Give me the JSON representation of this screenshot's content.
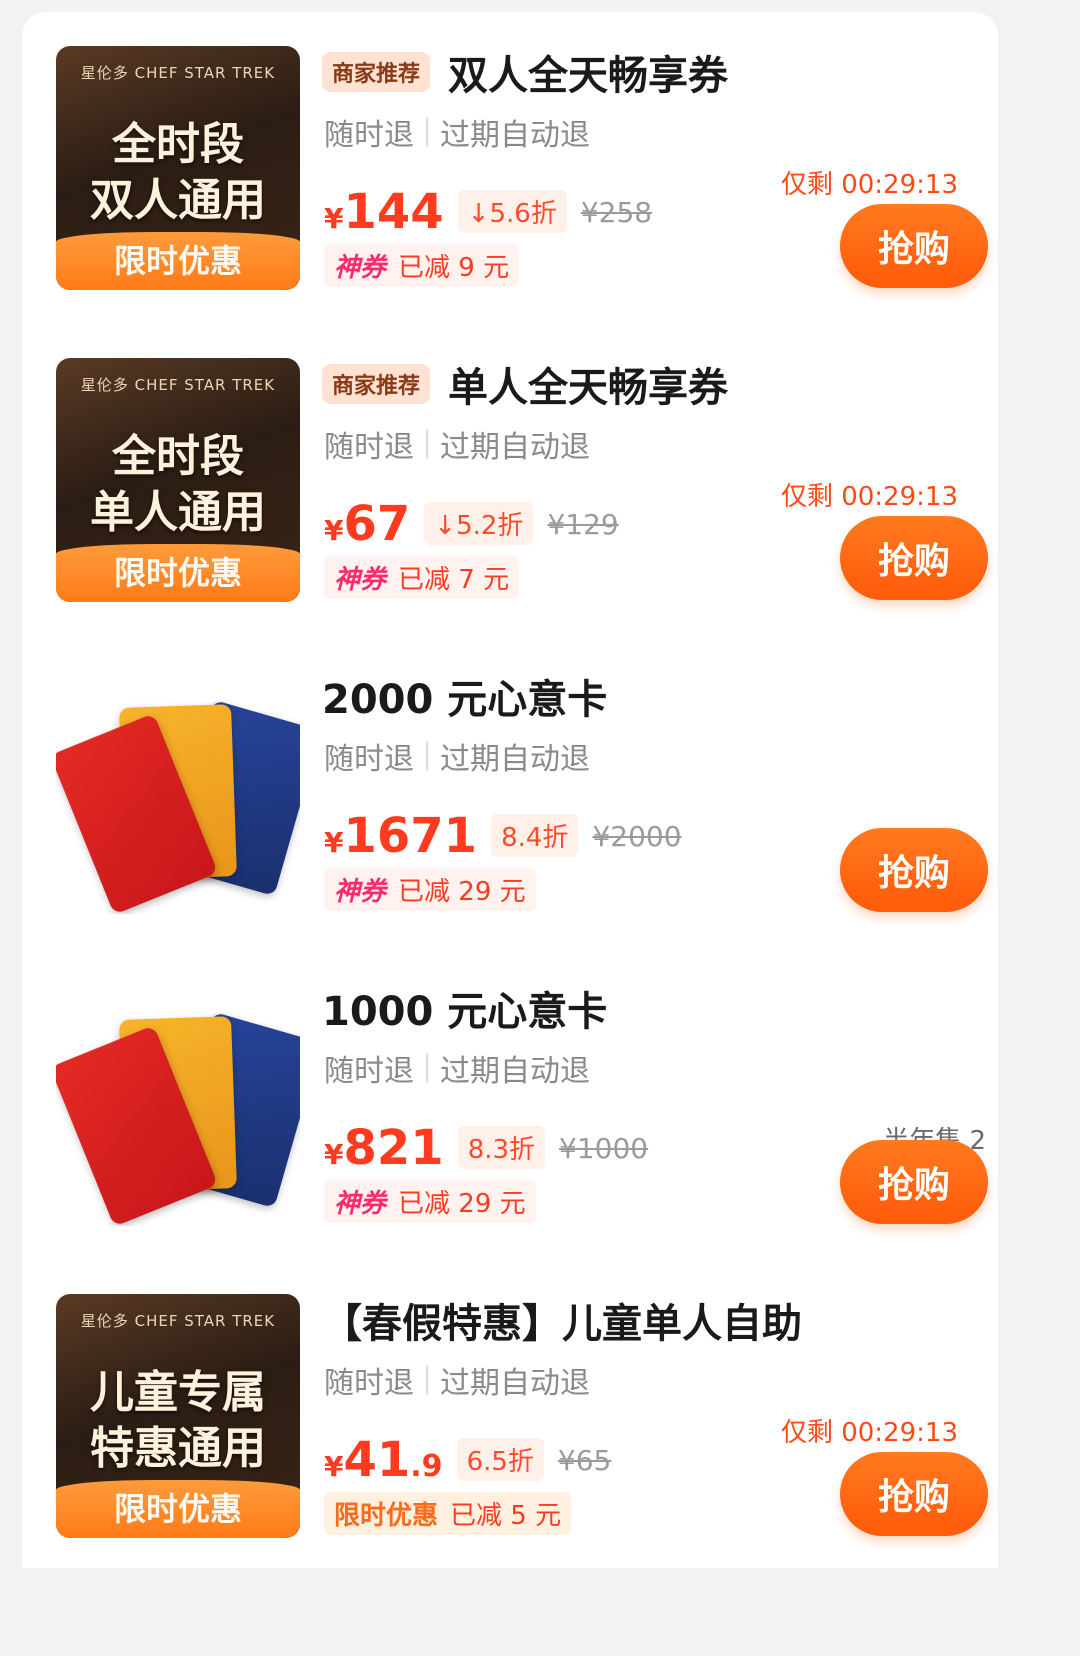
{
  "items": [
    {
      "id": "double",
      "thumb": {
        "brand": "星伦多 CHEF STAR TREK",
        "line1": "全时段",
        "line2": "双人通用",
        "band": "限时优惠"
      },
      "tag": "商家推荐",
      "title": "双人全天畅享券",
      "refund_any": "随时退",
      "refund_expired": "过期自动退",
      "currency": "¥",
      "price": "144",
      "discount": "5.6折",
      "original": "¥258",
      "coupon_kind": "神券",
      "coupon_amount": "已减 9 元",
      "countdown": "仅剩 00:29:13",
      "buy_label": "抢购"
    },
    {
      "id": "single",
      "thumb": {
        "brand": "星伦多 CHEF STAR TREK",
        "line1": "全时段",
        "line2": "单人通用",
        "band": "限时优惠"
      },
      "tag": "商家推荐",
      "title": "单人全天畅享券",
      "refund_any": "随时退",
      "refund_expired": "过期自动退",
      "currency": "¥",
      "price": "67",
      "discount": "5.2折",
      "original": "¥129",
      "coupon_kind": "神券",
      "coupon_amount": "已减 7 元",
      "countdown": "仅剩 00:29:13",
      "buy_label": "抢购"
    },
    {
      "id": "card2000",
      "title": "2000 元心意卡",
      "refund_any": "随时退",
      "refund_expired": "过期自动退",
      "currency": "¥",
      "price": "1671",
      "discount": "8.4折",
      "original": "¥2000",
      "coupon_kind": "神券",
      "coupon_amount": "已减 29 元",
      "buy_label": "抢购"
    },
    {
      "id": "card1000",
      "title": "1000 元心意卡",
      "refund_any": "随时退",
      "refund_expired": "过期自动退",
      "currency": "¥",
      "price": "821",
      "discount": "8.3折",
      "original": "¥1000",
      "coupon_kind": "神券",
      "coupon_amount": "已减 29 元",
      "sold": "半年售 2",
      "buy_label": "抢购"
    },
    {
      "id": "kids",
      "thumb": {
        "brand": "星伦多 CHEF STAR TREK",
        "line1": "儿童专属",
        "line2": "特惠通用",
        "band": "限时优惠"
      },
      "title": "【春假特惠】儿童单人自助",
      "refund_any": "随时退",
      "refund_expired": "过期自动退",
      "currency": "¥",
      "price": "41",
      "price_decimal": ".9",
      "discount": "6.5折",
      "original": "¥65",
      "coupon_kind": "限时优惠",
      "coupon_amount": "已减 5 元",
      "countdown": "仅剩 00:29:13",
      "buy_label": "抢购"
    }
  ],
  "colors": {
    "accent": "#ff5a0a",
    "price": "#ff3b1f",
    "coupon_pink": "#ff2a6d"
  },
  "icons": {
    "discount_arrow": "down-arrow-icon"
  }
}
